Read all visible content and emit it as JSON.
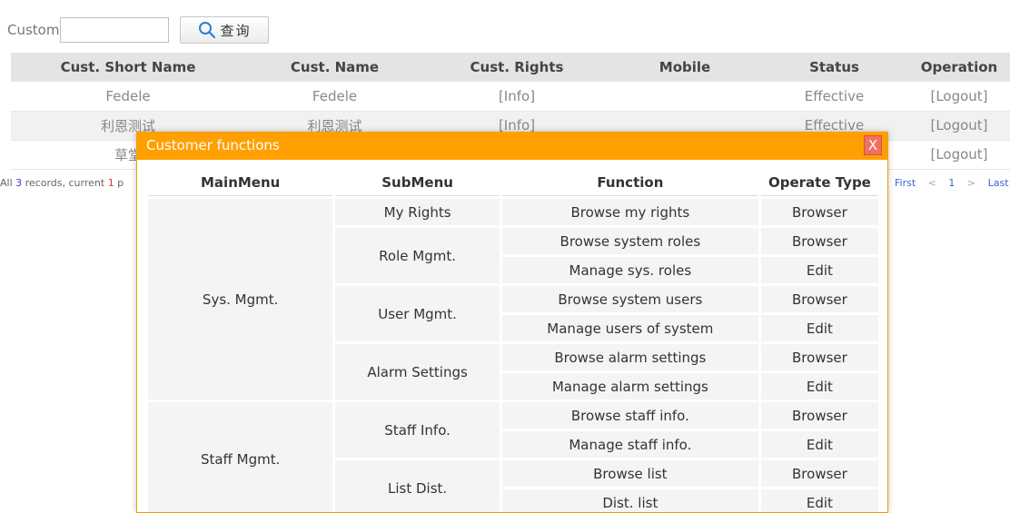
{
  "search": {
    "label": "Custom",
    "value": "",
    "placeholder": "",
    "button_label": "查询"
  },
  "customer_table": {
    "headers": [
      "Cust. Short Name",
      "Cust. Name",
      "Cust. Rights",
      "Mobile",
      "Status",
      "Operation"
    ],
    "rows": [
      {
        "short_name": "Fedele",
        "name": "Fedele",
        "rights": "[Info]",
        "mobile": "",
        "status": "Effective",
        "operation": "[Logout]"
      },
      {
        "short_name": "利恩测试",
        "name": "利恩测试",
        "rights": "[Info]",
        "mobile": "",
        "status": "Effective",
        "operation": "[Logout]"
      },
      {
        "short_name": "草堂",
        "name": "",
        "rights": "",
        "mobile": "",
        "status": "",
        "operation": "[Logout]"
      }
    ]
  },
  "pager": {
    "prefix": "All ",
    "total": "3",
    "mid": " records, current ",
    "current": "1",
    "suffix": " p",
    "first": "First",
    "prev": "<",
    "page": "1",
    "next": ">",
    "last": "Last"
  },
  "dialog": {
    "title": "Customer functions",
    "close_label": "X",
    "headers": [
      "MainMenu",
      "SubMenu",
      "Function",
      "Operate Type"
    ],
    "main_menus": [
      "Sys. Mgmt.",
      "Staff Mgmt."
    ],
    "sub_menus": [
      "My Rights",
      "Role Mgmt.",
      "User Mgmt.",
      "Alarm Settings",
      "Staff Info.",
      "List Dist."
    ],
    "functions": [
      {
        "function": "Browse my rights",
        "type": "Browser"
      },
      {
        "function": "Browse system roles",
        "type": "Browser"
      },
      {
        "function": "Manage sys. roles",
        "type": "Edit"
      },
      {
        "function": "Browse system users",
        "type": "Browser"
      },
      {
        "function": "Manage users of system",
        "type": "Edit"
      },
      {
        "function": "Browse alarm settings",
        "type": "Browser"
      },
      {
        "function": "Manage alarm settings",
        "type": "Edit"
      },
      {
        "function": "Browse staff info.",
        "type": "Browser"
      },
      {
        "function": "Manage staff info.",
        "type": "Edit"
      },
      {
        "function": "Browse list",
        "type": "Browser"
      },
      {
        "function": "Dist. list",
        "type": "Edit"
      }
    ]
  },
  "colors": {
    "dialog_header": "#ffa000",
    "link": "#3c3ccc",
    "close_button": "#f07060"
  }
}
